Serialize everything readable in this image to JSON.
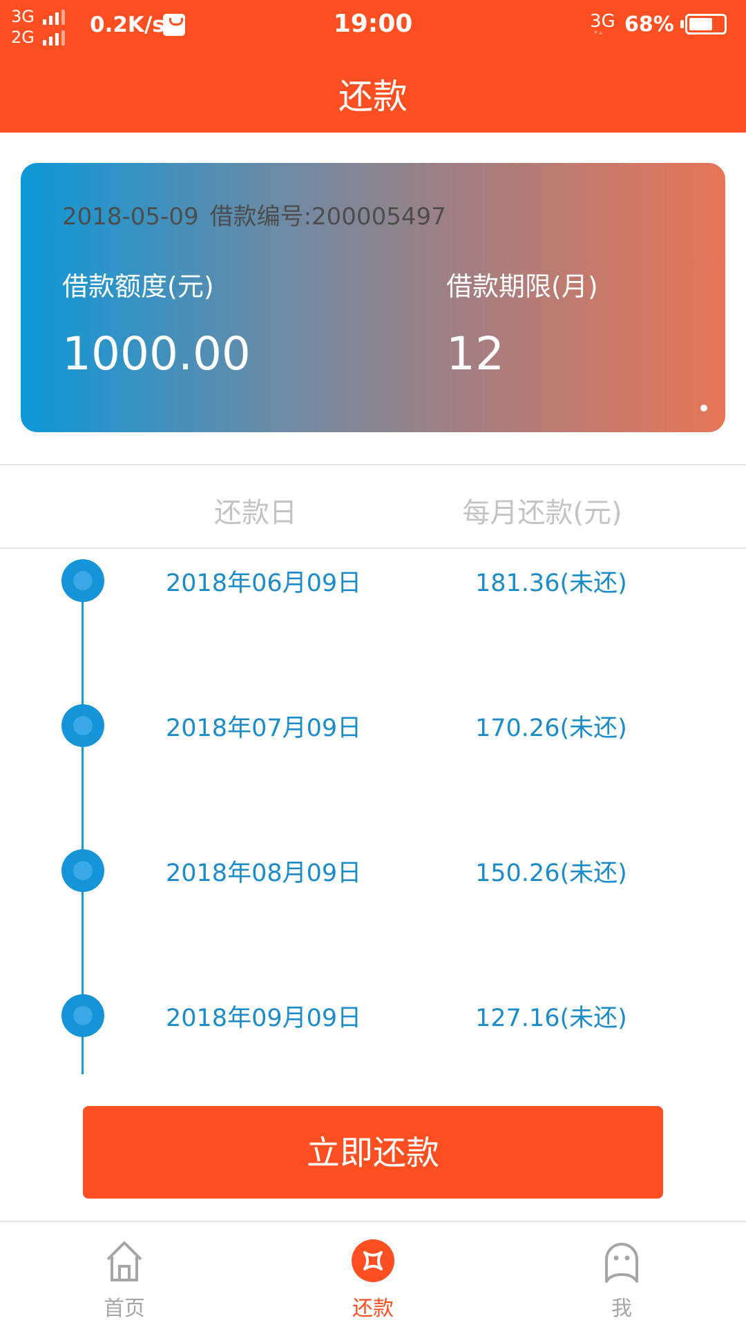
{
  "status_bar": {
    "network_1": "3G",
    "network_2": "2G",
    "speed": "0.2K/s",
    "time": "19:00",
    "network_right": "3G",
    "battery": "68%",
    "battery_level": 0.68
  },
  "header": {
    "title": "还款"
  },
  "loan_card": {
    "date": "2018-05-09",
    "loan_no": "借款编号:200005497",
    "amount_label": "借款额度(元)",
    "amount_value": "1000.00",
    "term_label": "借款期限(月)",
    "term_value": "12"
  },
  "schedule": {
    "date_header": "还款日",
    "amount_header": "每月还款(元)",
    "rows": [
      {
        "date": "2018年06月09日",
        "amount": "181.36(未还)"
      },
      {
        "date": "2018年07月09日",
        "amount": "170.26(未还)"
      },
      {
        "date": "2018年08月09日",
        "amount": "150.26(未还)"
      },
      {
        "date": "2018年09月09日",
        "amount": "127.16(未还)"
      }
    ]
  },
  "pay_button": "立即还款",
  "bottom_nav": {
    "items": [
      {
        "label": "首页",
        "icon": "home-icon",
        "active": false
      },
      {
        "label": "还款",
        "icon": "repay-icon",
        "active": true
      },
      {
        "label": "我",
        "icon": "user-icon",
        "active": false
      }
    ]
  },
  "colors": {
    "brand": "#fd4f22",
    "accent_blue": "#1b8bc9",
    "inactive_gray": "#a6a6a6"
  }
}
